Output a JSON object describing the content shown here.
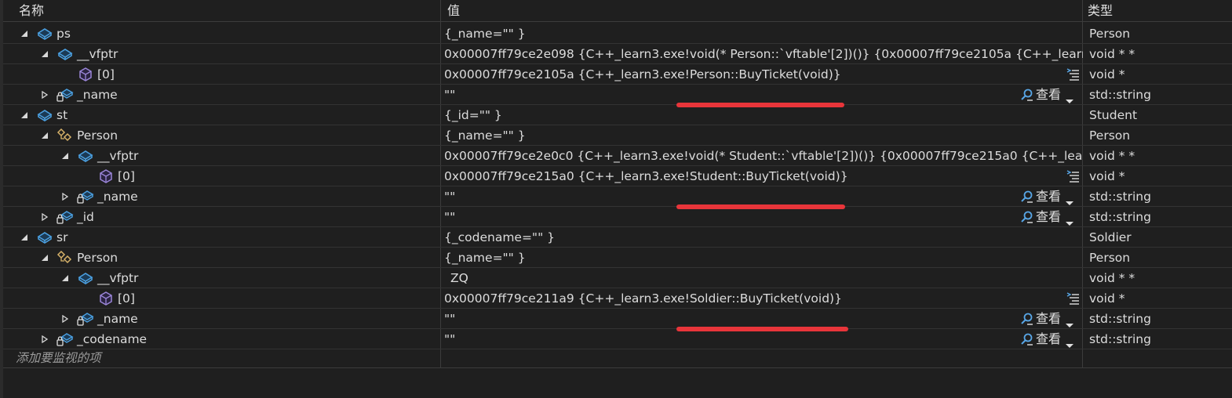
{
  "header": {
    "name_col": "名称",
    "value_col": "值",
    "type_col": "类型"
  },
  "rows": [
    {
      "name": "ps",
      "value": "{_name=\"\" }",
      "type": "Person"
    },
    {
      "name": "__vfptr",
      "value": "0x00007ff79ce2e098 {C++_learn3.exe!void(* Person::`vftable'[2])()} {0x00007ff79ce2105a {C++_learn3....",
      "type": "void * *"
    },
    {
      "name": "[0]",
      "value": "0x00007ff79ce2105a {C++_learn3.exe!Person::BuyTicket(void)}",
      "type": "void *"
    },
    {
      "name": "_name",
      "value": "\"\"",
      "type": "std::string"
    },
    {
      "name": "st",
      "value": "{_id=\"\" }",
      "type": "Student"
    },
    {
      "name": "Person",
      "value": "{_name=\"\" }",
      "type": "Person"
    },
    {
      "name": "__vfptr",
      "value": "0x00007ff79ce2e0c0 {C++_learn3.exe!void(* Student::`vftable'[2])()} {0x00007ff79ce215a0 {C++_learn3....",
      "type": "void * *"
    },
    {
      "name": "[0]",
      "value": "0x00007ff79ce215a0 {C++_learn3.exe!Student::BuyTicket(void)}",
      "type": "void *"
    },
    {
      "name": "_name",
      "value": "\"\"",
      "type": "std::string"
    },
    {
      "name": "_id",
      "value": "\"\"",
      "type": "std::string"
    },
    {
      "name": "sr",
      "value": "{_codename=\"\" }",
      "type": "Soldier"
    },
    {
      "name": "Person",
      "value": "{_name=\"\" }",
      "type": "Person"
    },
    {
      "name": "__vfptr",
      "value": "ZQ",
      "type": "void * *"
    },
    {
      "name": "[0]",
      "value": "0x00007ff79ce211a9 {C++_learn3.exe!Soldier::BuyTicket(void)}",
      "type": "void *"
    },
    {
      "name": "_name",
      "value": "\"\"",
      "type": "std::string"
    },
    {
      "name": "_codename",
      "value": "\"\"",
      "type": "std::string"
    }
  ],
  "view_label": "查看",
  "add_watch_placeholder": "添加要监视的项",
  "icons": {
    "expanded": "triangle-expanded-icon",
    "collapsed": "triangle-collapsed-icon",
    "field": "field-cube-icon",
    "private_field": "private-field-lock-icon",
    "base_class": "base-class-icon",
    "element": "element-cube-icon",
    "view": "magnifier-icon",
    "format": "format-list-icon"
  },
  "colors": {
    "background": "#1f1f1f",
    "text": "#dcdcdc",
    "highlight": "#e8353a",
    "field_icon": "#4a9fe0",
    "base_icon": "#d8b36a",
    "element_icon": "#9b86d9"
  }
}
